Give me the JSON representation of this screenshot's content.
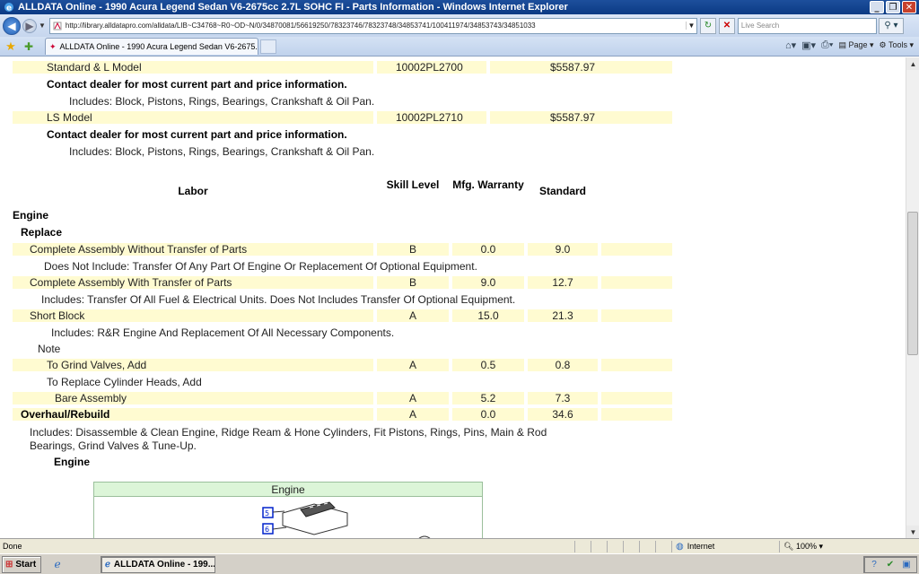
{
  "window": {
    "title": "ALLDATA Online - 1990 Acura Legend Sedan V6-2675cc 2.7L SOHC FI - Parts Information - Windows Internet Explorer"
  },
  "addressbar": {
    "url": "http://library.alldatapro.com/alldata/LIB~C34768~R0~OD~N/0/34870081/56619250/78323746/78323748/34853741/100411974/34853743/34851033",
    "search_placeholder": "Live Search"
  },
  "tabs": [
    {
      "label": "ALLDATA Online - 1990 Acura Legend Sedan V6-2675..."
    }
  ],
  "commands": {
    "page": "Page",
    "tools": "Tools"
  },
  "parts": [
    {
      "name": "Standard & L Model",
      "number": "10002PL2700",
      "price": "$5587.97",
      "note": "Contact dealer for most current part and price information.",
      "includes": "Includes: Block, Pistons, Rings, Bearings, Crankshaft & Oil Pan."
    },
    {
      "name": "LS Model",
      "number": "10002PL2710",
      "price": "$5587.97",
      "note": "Contact dealer for most current part and price information.",
      "includes": "Includes: Block, Pistons, Rings, Bearings, Crankshaft & Oil Pan."
    }
  ],
  "labor_headers": {
    "labor": "Labor",
    "skill": "Skill Level",
    "warranty": "Mfg. Warranty",
    "standard": "Standard"
  },
  "labor": {
    "section": "Engine",
    "subsection": "Replace",
    "items": [
      {
        "name": "Complete Assembly Without Transfer of Parts",
        "skill": "B",
        "warranty": "0.0",
        "standard": "9.0"
      },
      {
        "name": "Complete Assembly With Transfer of Parts",
        "skill": "B",
        "warranty": "9.0",
        "standard": "12.7"
      },
      {
        "name": "Short Block",
        "skill": "A",
        "warranty": "15.0",
        "standard": "21.3"
      },
      {
        "name": "To Grind Valves, Add",
        "skill": "A",
        "warranty": "0.5",
        "standard": "0.8"
      },
      {
        "name": "Bare Assembly",
        "skill": "A",
        "warranty": "5.2",
        "standard": "7.3"
      },
      {
        "name": "Overhaul/Rebuild",
        "skill": "A",
        "warranty": "0.0",
        "standard": "34.6"
      }
    ],
    "notes": {
      "item0": "Does Not Include: Transfer Of Any Part Of Engine Or Replacement Of Optional Equipment.",
      "item1": "Includes: Transfer Of All Fuel & Electrical Units. Does Not Includes Transfer Of Optional Equipment.",
      "item2": "Includes: R&R Engine And Replacement Of All Necessary Components.",
      "note_label": "Note",
      "replace_heads": "To Replace Cylinder Heads, Add",
      "overhaul_line1": "Includes: Disassemble & Clean Engine, Ridge Ream & Hone Cylinders, Fit Pistons, Rings, Pins, Main & Rod",
      "overhaul_line2": "Bearings, Grind Valves & Tune-Up."
    }
  },
  "figure": {
    "heading": "Engine",
    "title": "Engine",
    "callouts": [
      "5",
      "6"
    ]
  },
  "statusbar": {
    "status": "Done",
    "zone": "Internet",
    "zoom": "100%"
  },
  "taskbar": {
    "start": "Start",
    "task": "ALLDATA Online - 199..."
  }
}
